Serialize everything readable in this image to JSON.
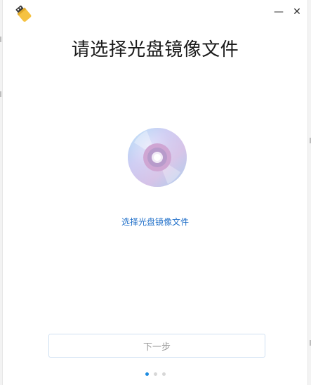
{
  "window": {
    "minimize_glyph": "—",
    "close_glyph": "✕",
    "app_icon": "usb-drive-icon"
  },
  "main": {
    "title": "请选择光盘镜像文件",
    "disc_icon": "disc-icon",
    "select_link": "选择光盘镜像文件",
    "next_button": "下一步"
  },
  "pager": {
    "count": 3,
    "active_index": 0
  },
  "colors": {
    "link": "#1f6fc9",
    "accent": "#1f8ce0",
    "app_icon_yellow": "#f5c242"
  }
}
